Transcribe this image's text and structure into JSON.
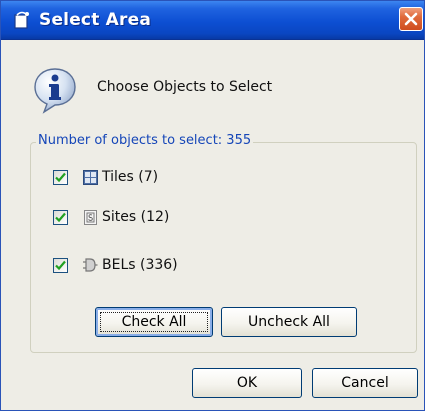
{
  "window": {
    "title": "Select Area",
    "icons": {
      "app": "window-app-icon",
      "close": "close-icon"
    }
  },
  "prompt": {
    "icon": "info-icon",
    "text": "Choose Objects to Select"
  },
  "group": {
    "title": "Number of objects to select: 355",
    "items": [
      {
        "icon": "tiles-grid-icon",
        "label": "Tiles (7)",
        "checked": true
      },
      {
        "icon": "sites-icon",
        "label": "Sites (12)",
        "checked": true
      },
      {
        "icon": "bels-icon",
        "label": "BELs (336)",
        "checked": true
      }
    ]
  },
  "buttons": {
    "check_all": "Check All",
    "uncheck_all": "Uncheck All",
    "ok": "OK",
    "cancel": "Cancel"
  },
  "colors": {
    "titlebar": "#0d4fd3",
    "close_button": "#e06a3b",
    "group_title": "#1546b8",
    "checkmark": "#21a121",
    "dialog_background": "#eeede6"
  }
}
